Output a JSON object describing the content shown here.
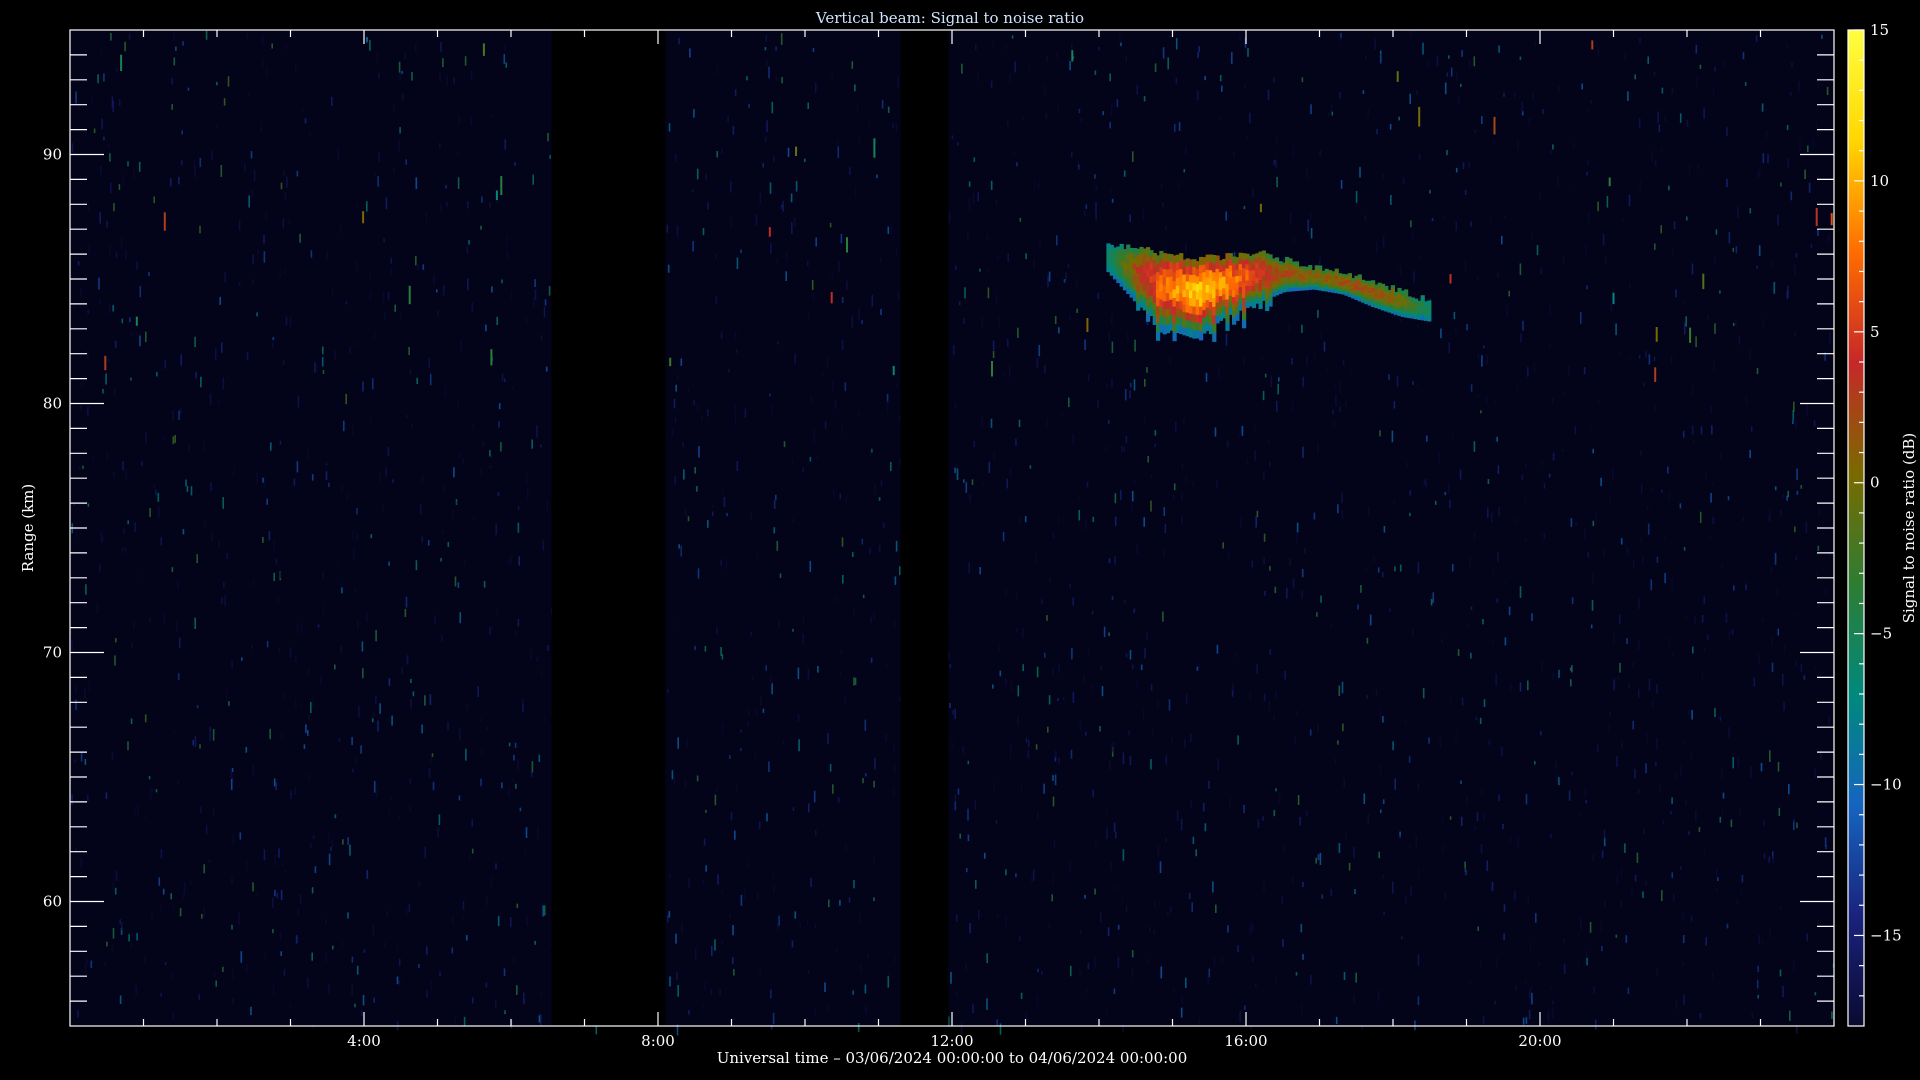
{
  "chart_data": {
    "type": "heatmap",
    "title": "Vertical beam: Signal to noise ratio",
    "xlabel": "Universal time – 03/06/2024 00:00:00 to 04/06/2024 00:00:00",
    "ylabel": "Range (km)",
    "colorbar_label": "Signal to noise ratio (dB)",
    "x_unit": "hours UT",
    "xlim": [
      0,
      24
    ],
    "ylim": [
      55,
      95
    ],
    "x_ticks": [
      {
        "value": 4,
        "label": "4:00"
      },
      {
        "value": 8,
        "label": "8:00"
      },
      {
        "value": 12,
        "label": "12:00"
      },
      {
        "value": 16,
        "label": "16:00"
      },
      {
        "value": 20,
        "label": "20:00"
      }
    ],
    "y_ticks": [
      {
        "value": 60,
        "label": "60"
      },
      {
        "value": 70,
        "label": "70"
      },
      {
        "value": 80,
        "label": "80"
      },
      {
        "value": 90,
        "label": "90"
      }
    ],
    "colorbar_range": [
      -18,
      15
    ],
    "colorbar_ticks": [
      {
        "value": 15,
        "label": "15"
      },
      {
        "value": 10,
        "label": "10"
      },
      {
        "value": 5,
        "label": "5"
      },
      {
        "value": 0,
        "label": "0"
      },
      {
        "value": -5,
        "label": "−5"
      },
      {
        "value": -10,
        "label": "−10"
      },
      {
        "value": -15,
        "label": "−15"
      }
    ],
    "colormap": [
      "#0a0a30",
      "#1a237e",
      "#1565c0",
      "#00897b",
      "#2e7d32",
      "#7a6a00",
      "#c62828",
      "#ff6d00",
      "#ffd600",
      "#ffff40"
    ],
    "data_gaps_hours": [
      [
        6.55,
        8.1
      ],
      [
        11.3,
        11.95
      ]
    ],
    "echo_layer": {
      "description_points": [
        {
          "time": 14.1,
          "range_top": 86.4,
          "range_bottom": 85.3,
          "peak_snr": -6
        },
        {
          "time": 14.5,
          "range_top": 86.3,
          "range_bottom": 84.0,
          "peak_snr": 3
        },
        {
          "time": 14.9,
          "range_top": 86.0,
          "range_bottom": 83.0,
          "peak_snr": 8
        },
        {
          "time": 15.3,
          "range_top": 85.8,
          "range_bottom": 82.6,
          "peak_snr": 11
        },
        {
          "time": 15.7,
          "range_top": 85.9,
          "range_bottom": 83.5,
          "peak_snr": 9
        },
        {
          "time": 16.1,
          "range_top": 86.1,
          "range_bottom": 84.0,
          "peak_snr": 6
        },
        {
          "time": 16.5,
          "range_top": 85.8,
          "range_bottom": 84.5,
          "peak_snr": 2
        },
        {
          "time": 16.9,
          "range_top": 85.5,
          "range_bottom": 84.6,
          "peak_snr": 1
        },
        {
          "time": 17.3,
          "range_top": 85.3,
          "range_bottom": 84.4,
          "peak_snr": 2
        },
        {
          "time": 17.7,
          "range_top": 84.9,
          "range_bottom": 83.9,
          "peak_snr": 2
        },
        {
          "time": 18.1,
          "range_top": 84.5,
          "range_bottom": 83.5,
          "peak_snr": 0
        },
        {
          "time": 18.5,
          "range_top": 84.1,
          "range_bottom": 83.3,
          "peak_snr": -6
        }
      ]
    }
  }
}
